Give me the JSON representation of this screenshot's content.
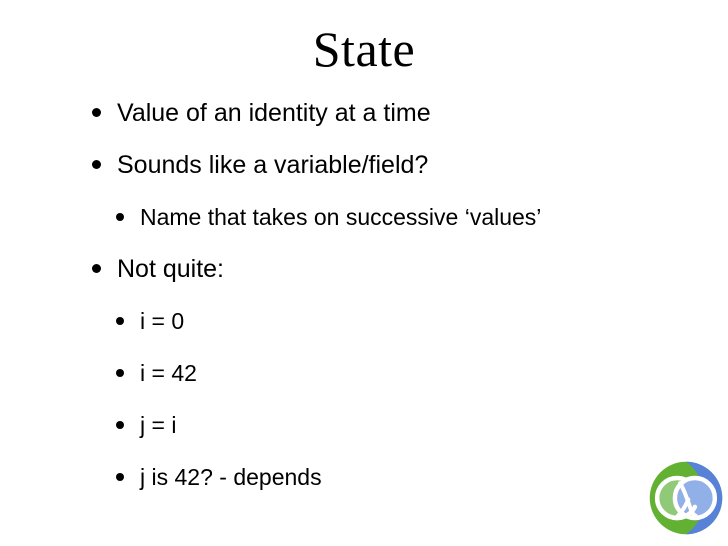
{
  "slide": {
    "title": "State",
    "background_color": "#ffffff",
    "text_color": "#000000",
    "bullets": [
      {
        "level": 1,
        "text": "Value of an identity at a time"
      },
      {
        "level": 1,
        "text": "Sounds like a variable/field?"
      },
      {
        "level": 2,
        "text": "Name that takes on successive ‘values’"
      },
      {
        "level": 1,
        "text": "Not quite:"
      },
      {
        "level": 2,
        "text": "i = 0"
      },
      {
        "level": 2,
        "text": "i = 42"
      },
      {
        "level": 2,
        "text": "j = i"
      },
      {
        "level": 2,
        "text": "j is 42? - depends"
      }
    ]
  },
  "logo": {
    "name": "clojure-logo",
    "blue": "#5881d8",
    "green": "#63b132",
    "light_blue": "#91b0e8",
    "light_green": "#90c978",
    "white": "#ffffff"
  }
}
